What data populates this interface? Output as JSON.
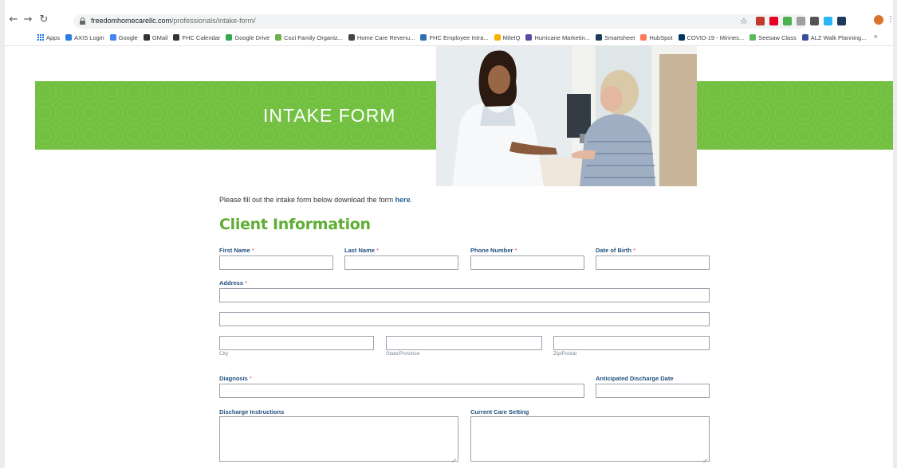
{
  "browser": {
    "url_domain": "freedomhomecarellc.com",
    "url_path": "/professionals/intake-form/",
    "bookmarks": [
      {
        "label": "Apps",
        "color": "#1a73e8"
      },
      {
        "label": "AXIS Login",
        "color": "#2c7be5"
      },
      {
        "label": "Google",
        "color": "#4285f4"
      },
      {
        "label": "GMail",
        "color": "#333333"
      },
      {
        "label": "FHC Calendar",
        "color": "#333333"
      },
      {
        "label": "Google Drive",
        "color": "#34a853"
      },
      {
        "label": "Cozi Family Organiz...",
        "color": "#6ab04c"
      },
      {
        "label": "Home Care Revenu...",
        "color": "#444444"
      },
      {
        "label": "FHC Employee Intra...",
        "color": "#2f6fb3"
      },
      {
        "label": "MileIQ",
        "color": "#f4b400"
      },
      {
        "label": "Hurricane Marketin...",
        "color": "#5b4aa5"
      },
      {
        "label": "Smartsheet",
        "color": "#1f3c5a"
      },
      {
        "label": "HubSpot",
        "color": "#ff7a59"
      },
      {
        "label": "COVID-19 - Minnes...",
        "color": "#003865"
      },
      {
        "label": "Seesaw Class",
        "color": "#5cb85c"
      },
      {
        "label": "ALZ Walk Planning...",
        "color": "#3b4d9b"
      }
    ],
    "bookmarks_more": "»",
    "extension_colors": [
      "#c0392b",
      "#e60023",
      "#4caf50",
      "#9e9e9e",
      "#555555",
      "#29b6f6",
      "#1e3a5f"
    ]
  },
  "banner": {
    "title": "INTAKE FORM",
    "accent": "#72c040"
  },
  "form": {
    "intro_text": "Please fill out the intake form below download the form ",
    "intro_link": "here",
    "intro_end": ".",
    "section_title": "Client Information",
    "required_mark": "*",
    "labels": {
      "first_name": "First Name",
      "last_name": "Last Name",
      "phone": "Phone Number",
      "dob": "Date of Birth",
      "address": "Address",
      "city": "City",
      "state": "State/Province",
      "zip": "Zip/Postal",
      "diagnosis": "Diagnosis",
      "discharge_date": "Anticipated Discharge Date",
      "discharge_instructions": "Discharge Instructions",
      "care_setting": "Current Care Setting"
    },
    "values": {
      "first_name": "",
      "last_name": "",
      "phone": "",
      "dob": "",
      "address1": "",
      "address2": "",
      "city": "",
      "state": "",
      "zip": "",
      "diagnosis": "",
      "discharge_date": "",
      "discharge_instructions": "",
      "care_setting": ""
    }
  }
}
